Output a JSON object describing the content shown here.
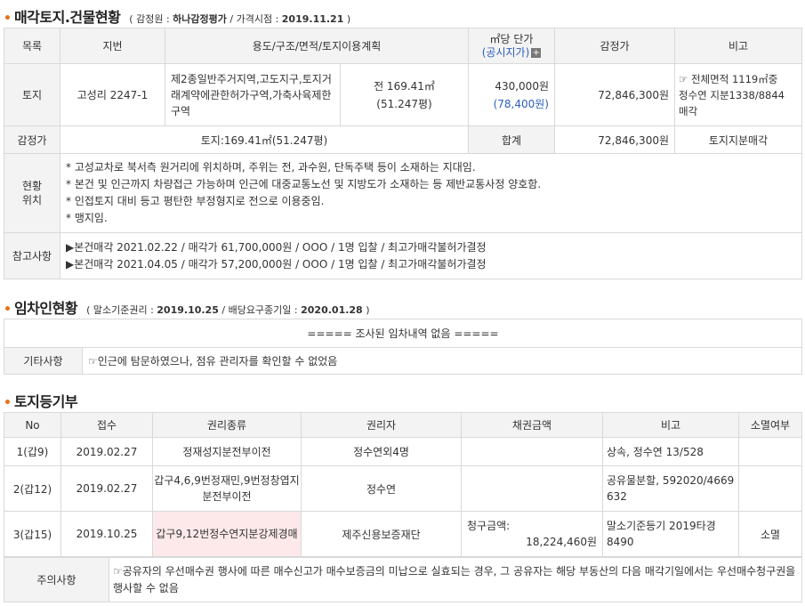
{
  "section1": {
    "title": "매각토지.건물현황",
    "sub_prefix": "( 감정원 : ",
    "appraiser": "하나감정평가",
    "sub_mid": " / 가격시점 : ",
    "price_date": "2019.11.21",
    "sub_suffix": " )",
    "headers": [
      "목록",
      "지번",
      "용도/구조/면적/토지이용계획",
      "㎡당 단가",
      "(공시지가)",
      "감정가",
      "비고"
    ],
    "land": {
      "label": "토지",
      "lot": "고성리 2247-1",
      "use": "제2종일반주거지역,고도지구,토지거래계약에관한허가구역,가축사육제한구역",
      "area1": "전 169.41㎡",
      "area2": "(51.247평)",
      "unit_price": "430,000원",
      "official_price": "(78,400원)",
      "appraisal": "72,846,300원",
      "note1": "☞ 전체면적 1119㎡중",
      "note2": "정수연 지분1338/8844",
      "note3": "매각"
    },
    "summary": {
      "label": "감정가",
      "land_text": "토지:169.41㎡(51.247평)",
      "total_label": "합계",
      "total": "72,846,300원",
      "note": "토지지분매각"
    },
    "location": {
      "label1": "현황",
      "label2": "위치",
      "lines": [
        "* 고성교차로 북서측 원거리에 위치하며, 주위는 전, 과수원, 단독주택 등이 소재하는 지대임.",
        "* 본건 및 인근까지 차량접근 가능하며 인근에 대중교통노선 및 지방도가 소재하는 등 제반교통사정 양호함.",
        "* 인접토지 대비 등고 평탄한 부정형지로 전으로 이용중임.",
        "* 맹지임."
      ]
    },
    "reference": {
      "label": "참고사항",
      "lines": [
        "▶본건매각 2021.02.22 / 매각가 61,700,000원 / OOO / 1명 입찰 / 최고가매각불허가결정",
        "▶본건매각 2021.04.05 / 매각가 57,200,000원 / OOO / 1명 입찰 / 최고가매각불허가결정"
      ]
    }
  },
  "section2": {
    "title": "임차인현황",
    "sub_prefix": "( 말소기준권리 : ",
    "base_right_date": "2019.10.25",
    "sub_mid": " / 배당요구종기일 : ",
    "dividend_date": "2020.01.28",
    "sub_suffix": " )",
    "no_tenant": "===== 조사된 임차내역 없음 =====",
    "etc_label": "기타사항",
    "etc_text": "☞인근에 탐문하였으나, 점유 관리자를 확인할 수 없었음"
  },
  "section3": {
    "title": "토지등기부",
    "headers": [
      "No",
      "접수",
      "권리종류",
      "권리자",
      "채권금액",
      "비고",
      "소멸여부"
    ],
    "rows": [
      {
        "no": "1(갑9)",
        "date": "2019.02.27",
        "kind": "정재성지분전부이전",
        "holder": "정수연외4명",
        "amount_label": "",
        "amount": "",
        "note": "상속, 정수연 13/528",
        "extinct": ""
      },
      {
        "no": "2(갑12)",
        "date": "2019.02.27",
        "kind": "갑구4,6,9번정재민,9번정창엽지분전부이전",
        "holder": "정수연",
        "amount_label": "",
        "amount": "",
        "note": "공유물분할, 592020/4669632",
        "extinct": ""
      },
      {
        "no": "3(갑15)",
        "date": "2019.10.25",
        "kind": "갑구9,12번정수연지분강제경매",
        "holder": "제주신용보증재단",
        "amount_label": "청구금액:",
        "amount": "18,224,460원",
        "note": "말소기준등기 2019타경8490",
        "extinct": "소멸"
      }
    ],
    "caution_label": "주의사항",
    "caution_text": "☞공유자의 우선매수권 행사에 따른 매수신고가 매수보증금의 미납으로 실효되는 경우, 그 공유자는 해당 부동산의 다음 매각기일에서는 우선매수청구권을 행사할 수 없음"
  }
}
